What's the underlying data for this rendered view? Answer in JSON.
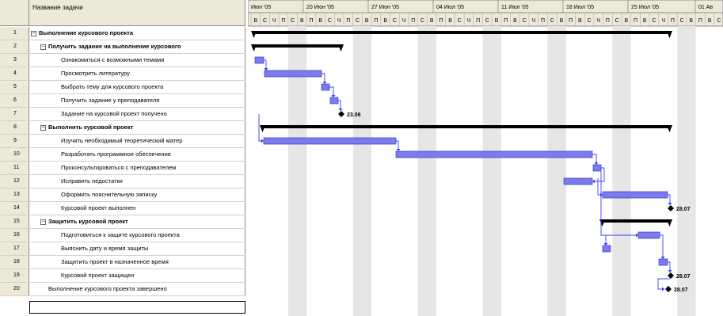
{
  "header": {
    "name_column": "Название задачи"
  },
  "weeks": [
    "Июн '05",
    "20 Июн '05",
    "27 Июн '05",
    "04 Июл '05",
    "11 Июл '05",
    "18 Июл '05",
    "25 Июл '05",
    "01 Ав"
  ],
  "day_letters": [
    "В",
    "С",
    "Ч",
    "П",
    "С",
    "В",
    "П"
  ],
  "tasks": [
    {
      "id": "1",
      "name": "Выполнение курсового проекта",
      "summary": true,
      "toggle": "−"
    },
    {
      "id": "2",
      "name": "Получить задание на выполнение курсового",
      "summary": true,
      "toggle": "−"
    },
    {
      "id": "3",
      "name": "Ознакомиться с возможными темами"
    },
    {
      "id": "4",
      "name": "Просмотреть литературу"
    },
    {
      "id": "5",
      "name": "Выбрать тему для курсового проекта"
    },
    {
      "id": "6",
      "name": "Получить задание у преподавателя"
    },
    {
      "id": "7",
      "name": "Задание на курсовой проект получено"
    },
    {
      "id": "8",
      "name": "Выполнить курсовой проект",
      "summary": true,
      "toggle": "−"
    },
    {
      "id": "9",
      "name": "Изучить необходимый теоретический матер"
    },
    {
      "id": "10",
      "name": "Разработать программное обеспечение"
    },
    {
      "id": "11",
      "name": "Проконсультироваться с преподавателем"
    },
    {
      "id": "12",
      "name": "Исправить недостатки"
    },
    {
      "id": "13",
      "name": "Оформить пояснительную записку"
    },
    {
      "id": "14",
      "name": "Курсовой проект выполнен"
    },
    {
      "id": "15",
      "name": "Защитить курсовой проект",
      "summary": true,
      "toggle": "−"
    },
    {
      "id": "16",
      "name": "Подготовиться к защите курсового проекта"
    },
    {
      "id": "17",
      "name": "Выяснить дату и время защиты"
    },
    {
      "id": "18",
      "name": "Защитить проект в назначенное время"
    },
    {
      "id": "19",
      "name": "Курсовой проект защищен"
    },
    {
      "id": "20",
      "name": "Выполнение курсового проекта завершено"
    }
  ],
  "milestones": {
    "m7": "23.06",
    "m14": "28.07",
    "m19": "28.07",
    "m20": "28.07"
  },
  "colors": {
    "task_bar": "#7b7bf0",
    "summary_bar": "#000000",
    "weekend_shade": "#e6e6e6",
    "header_bg": "#ece9d8"
  }
}
